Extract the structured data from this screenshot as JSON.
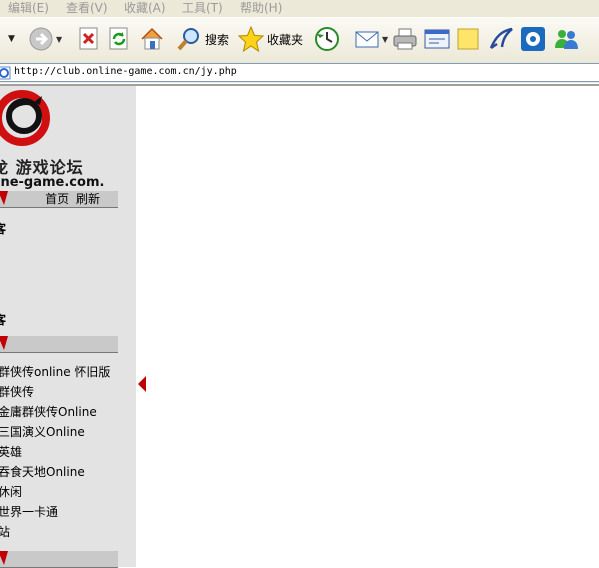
{
  "menubar": {
    "items": [
      "编辑(E)",
      "查看(V)",
      "收藏(A)",
      "工具(T)",
      "帮助(H)"
    ]
  },
  "toolbar": {
    "search_label": "搜索",
    "favorites_label": "收藏夹",
    "icons": [
      "back-dropdown-icon",
      "forward-icon",
      "stop-icon",
      "refresh-icon",
      "home-icon",
      "search-icon",
      "favorites-icon",
      "history-icon",
      "mail-icon",
      "print-icon",
      "edit-icon",
      "discuss-icon",
      "messenger-icon",
      "media-icon",
      "users-icon"
    ]
  },
  "address": {
    "url": "http://club.online-game.com.cn/jy.php"
  },
  "sidebar": {
    "site_title_cn": "龙 游戏论坛",
    "site_domain": "ine-game.com.",
    "bar1_links": [
      "首页",
      "刷新"
    ],
    "section_a": "客",
    "section_b": "客",
    "game_links": [
      "群侠传online 怀旧版",
      "群侠传",
      "金庸群侠传Online",
      "三国演义Online",
      "英雄",
      "吞食天地Online",
      "休闲",
      "世界一卡通",
      "站"
    ]
  },
  "colors": {
    "accent_red": "#c00000",
    "sidebar_bg": "#e3e3e3",
    "chrome_bg": "#ece9d8"
  }
}
